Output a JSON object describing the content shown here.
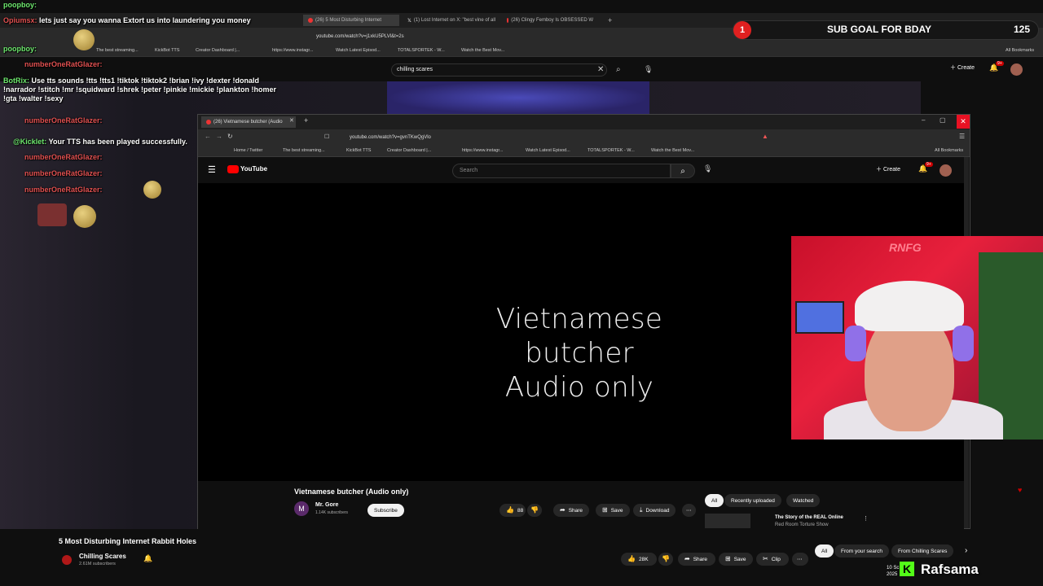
{
  "bg_browser": {
    "tabs": [
      {
        "label": "(26) 5 Most Disturbing Internet"
      },
      {
        "label": "(1) Lost Internet on X: \"best vine of all"
      },
      {
        "label": "(26) Clingy Femboy Is OBSESSED W"
      }
    ],
    "url": "youtube.com/watch?v=j1xkU5PLVl&t=2s",
    "bookmarks": [
      "The best streaming...",
      "KickBot TTS",
      "Creator Dashboard |...",
      "https://www.instagr...",
      "Watch Latest Episod...",
      "TOTALSPORTEK - W...",
      "Watch the Best Mov...",
      "All Bookmarks"
    ],
    "search_value": "chilling scares",
    "create_label": "Create",
    "notif_count": "9+",
    "video_title": "5 Most Disturbing Internet Rabbit Holes",
    "channel": "Chilling Scares",
    "subs": "2.61M subscribers",
    "likes": "28K",
    "share": "Share",
    "save": "Save",
    "clip": "Clip",
    "chips": [
      "All",
      "From your search",
      "From Chilling Scares"
    ],
    "side_title": "10 Sc",
    "side_year": "2025"
  },
  "chat": [
    {
      "user": "poopboy:",
      "text": "",
      "color": "green"
    },
    {
      "user": "Opiumsx:",
      "text": "lets just say you wanna Extort us into laundering you money",
      "color": "red"
    },
    {
      "user": "poopboy:",
      "text": "",
      "color": "green"
    },
    {
      "user": "numberOneRatGlazer:",
      "text": "",
      "color": "red"
    },
    {
      "user": "BotRix:",
      "text": "Use tts sounds !tts !tts1 !tiktok !tiktok2 !brian !ivy !dexter !donald !narrador !stitch !mr !squidward !shrek !peter !pinkie !mickie !plankton !homer !gta !walter !sexy",
      "color": "green"
    },
    {
      "user": "numberOneRatGlazer:",
      "text": "",
      "color": "red"
    },
    {
      "user": "@Kicklet:",
      "text": "Your TTS has been played successfully.",
      "color": "green"
    },
    {
      "user": "numberOneRatGlazer:",
      "text": "",
      "color": "red"
    },
    {
      "user": "numberOneRatGlazer:",
      "text": "",
      "color": "red"
    },
    {
      "user": "numberOneRatGlazer:",
      "text": "",
      "color": "red"
    }
  ],
  "sub_goal": {
    "badge": "1",
    "title": "SUB GOAL FOR BDAY",
    "count": "125"
  },
  "main_window": {
    "tab_label": "(26) Vietnamese butcher (Audio",
    "url": "youtube.com/watch?v=gvnTKwQgVlo",
    "bookmarks": [
      "Home / Twitter",
      "The best streaming...",
      "KickBot TTS",
      "Creator Dashboard |...",
      "https://www.instagr...",
      "Watch Latest Episod...",
      "TOTALSPORTEK - W...",
      "Watch the Best Mov...",
      "All Bookmarks"
    ],
    "logo": "YouTube",
    "search_placeholder": "Search",
    "create_label": "Create",
    "notif_count": "9+",
    "video_line1": "Vietnamese butcher",
    "video_line2": "Audio only",
    "title": "Vietnamese butcher (Audio only)",
    "channel": "Mr. Gore",
    "channel_initial": "M",
    "subs": "1.14K subscribers",
    "subscribe": "Subscribe",
    "likes": "88",
    "share": "Share",
    "save": "Save",
    "download": "Download",
    "chips": [
      "All",
      "Recently uploaded",
      "Watched"
    ],
    "rec_title": "The Story of the REAL Online",
    "rec_sub": "Red Room Torture Show"
  },
  "webcam": {
    "logo": "RNFG"
  },
  "overlay": {
    "kick_name": "Rafsama",
    "kick_letter": "K"
  },
  "colors": {
    "yt_red": "#ff0000",
    "kick_green": "#53fc18",
    "close_red": "#e81123"
  }
}
